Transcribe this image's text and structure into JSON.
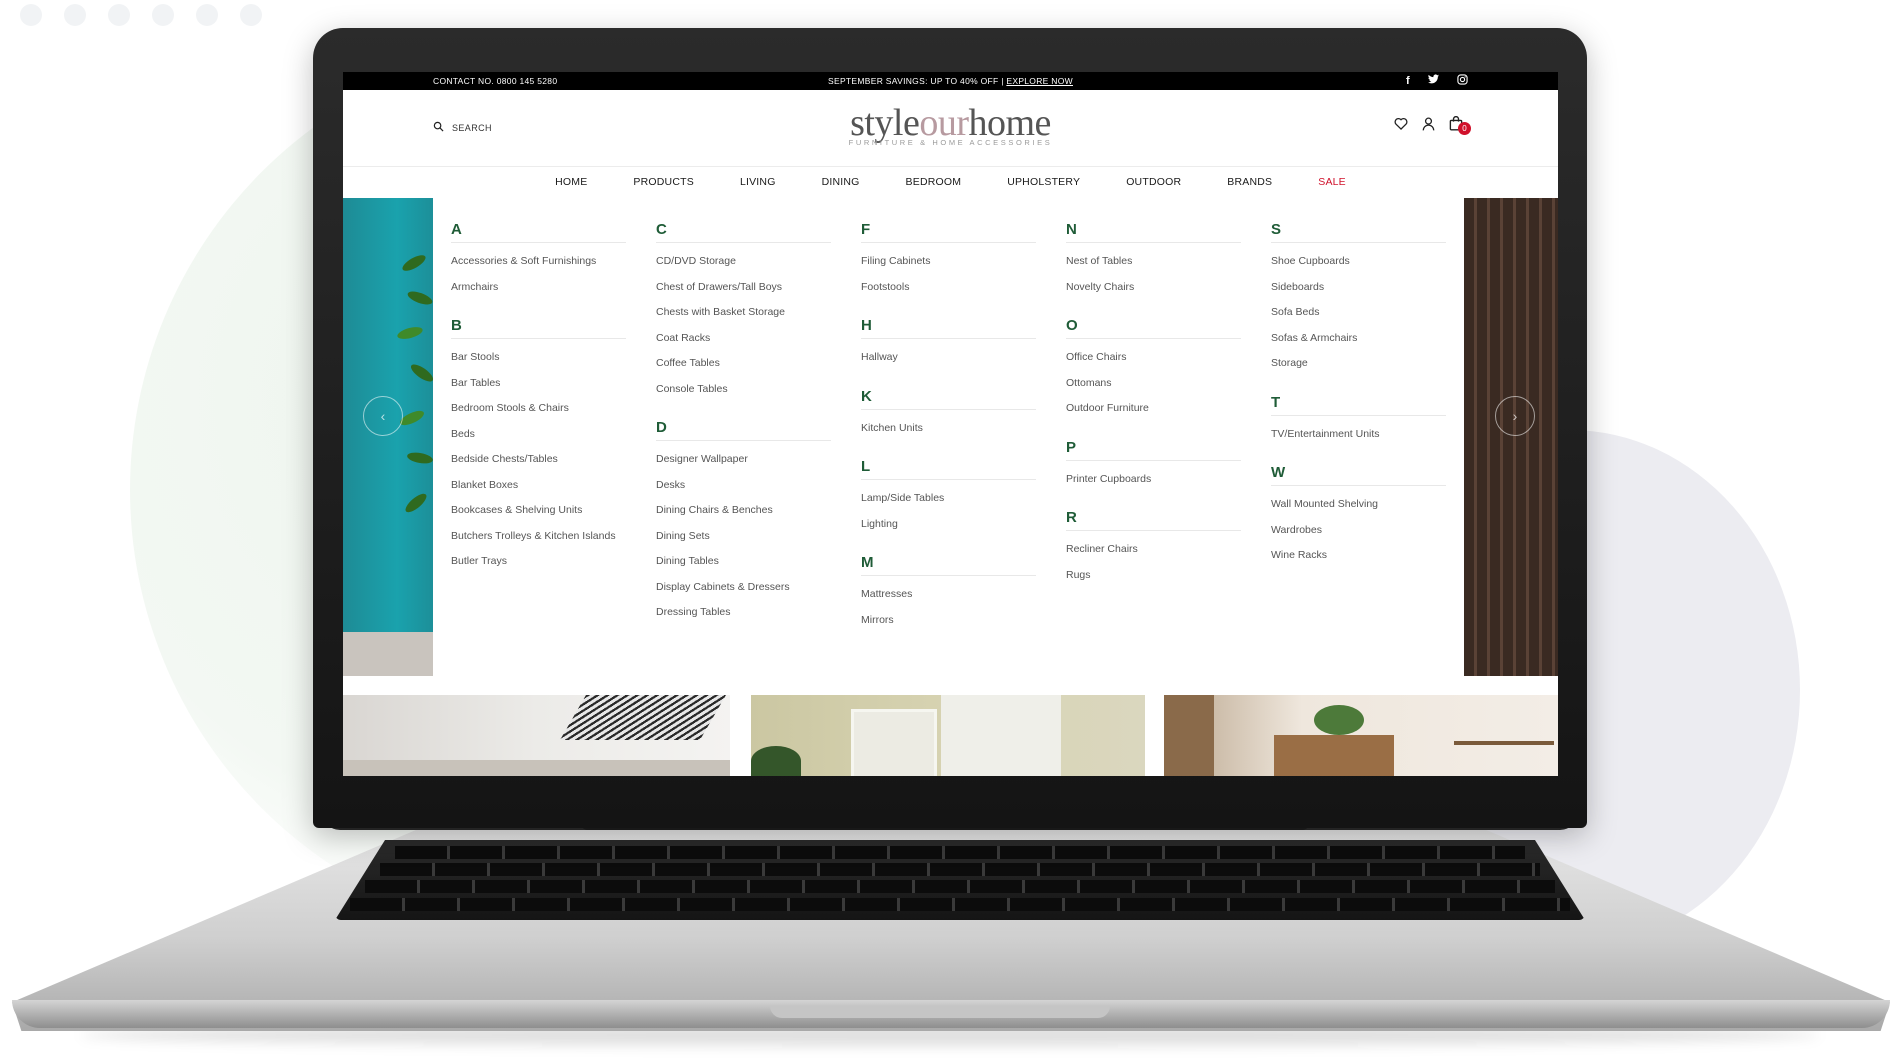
{
  "topbar": {
    "contact": "CONTACT NO. 0800 145 5280",
    "promo_text": "SEPTEMBER SAVINGS: UP TO 40% OFF | ",
    "promo_link": "EXPLORE NOW",
    "social_icons": [
      "facebook-icon",
      "twitter-icon",
      "instagram-icon"
    ]
  },
  "header": {
    "search_label": "SEARCH",
    "logo_part1": "style",
    "logo_part2": "our",
    "logo_part3": "home",
    "logo_tagline": "FURNITURE & HOME ACCESSORIES",
    "cart_count": "0"
  },
  "nav": {
    "items": [
      "HOME",
      "PRODUCTS",
      "LIVING",
      "DINING",
      "BEDROOM",
      "UPHOLSTERY",
      "OUTDOOR",
      "BRANDS",
      "SALE"
    ]
  },
  "colors": {
    "accent_green": "#1f5c37",
    "sale_red": "#d0112b",
    "logo_grey": "#555555",
    "logo_pink": "#b79aa0"
  },
  "mega_menu": {
    "columns": [
      {
        "groups": [
          {
            "letter": "A",
            "items": [
              "Accessories & Soft Furnishings",
              "Armchairs"
            ]
          },
          {
            "letter": "B",
            "items": [
              "Bar Stools",
              "Bar Tables",
              "Bedroom Stools & Chairs",
              "Beds",
              "Bedside Chests/Tables",
              "Blanket Boxes",
              "Bookcases & Shelving Units",
              "Butchers Trolleys & Kitchen Islands",
              "Butler Trays"
            ]
          }
        ]
      },
      {
        "groups": [
          {
            "letter": "C",
            "items": [
              "CD/DVD Storage",
              "Chest of Drawers/Tall Boys",
              "Chests with Basket Storage",
              "Coat Racks",
              "Coffee Tables",
              "Console Tables"
            ]
          },
          {
            "letter": "D",
            "items": [
              "Designer Wallpaper",
              "Desks",
              "Dining Chairs & Benches",
              "Dining Sets",
              "Dining Tables",
              "Display Cabinets & Dressers",
              "Dressing Tables"
            ]
          }
        ]
      },
      {
        "groups": [
          {
            "letter": "F",
            "items": [
              "Filing Cabinets",
              "Footstools"
            ]
          },
          {
            "letter": "H",
            "items": [
              "Hallway"
            ]
          },
          {
            "letter": "K",
            "items": [
              "Kitchen Units"
            ]
          },
          {
            "letter": "L",
            "items": [
              "Lamp/Side Tables",
              "Lighting"
            ]
          },
          {
            "letter": "M",
            "items": [
              "Mattresses",
              "Mirrors"
            ]
          }
        ]
      },
      {
        "groups": [
          {
            "letter": "N",
            "items": [
              "Nest of Tables",
              "Novelty Chairs"
            ]
          },
          {
            "letter": "O",
            "items": [
              "Office Chairs",
              "Ottomans",
              "Outdoor Furniture"
            ]
          },
          {
            "letter": "P",
            "items": [
              "Printer Cupboards"
            ]
          },
          {
            "letter": "R",
            "items": [
              "Recliner Chairs",
              "Rugs"
            ]
          }
        ]
      },
      {
        "groups": [
          {
            "letter": "S",
            "items": [
              "Shoe Cupboards",
              "Sideboards",
              "Sofa Beds",
              "Sofas & Armchairs",
              "Storage"
            ]
          },
          {
            "letter": "T",
            "items": [
              "TV/Entertainment Units"
            ]
          },
          {
            "letter": "W",
            "items": [
              "Wall Mounted Shelving",
              "Wardrobes",
              "Wine Racks"
            ]
          }
        ]
      }
    ]
  },
  "slider": {
    "prev_icon": "chevron-left-icon",
    "next_icon": "chevron-right-icon"
  }
}
